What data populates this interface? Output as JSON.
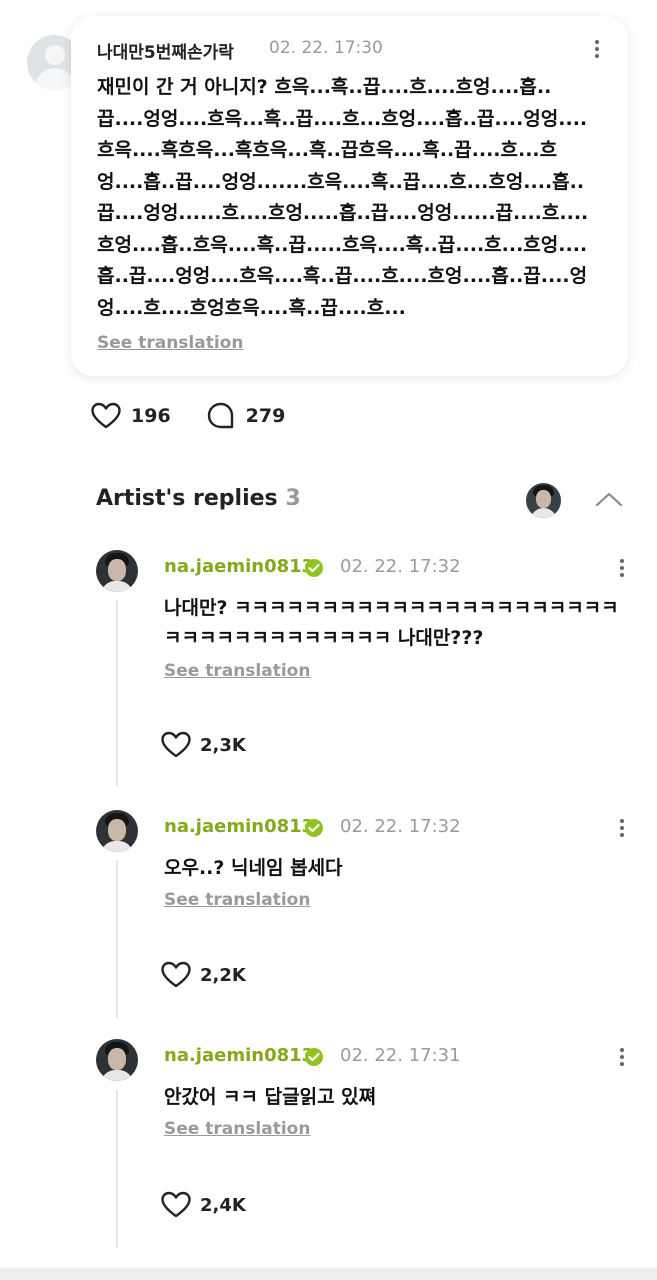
{
  "post": {
    "author": "나대만5번째손가락",
    "time": "02. 22. 17:30",
    "text": "재민이 간 거 아니지? 흐윽...흑..끕....흐....흐엉....흡..끕....엉엉....흐윽...흑..끕....흐...흐엉....흡..끕....엉엉....흐윽....흑흐윽...흑흐윽...흑..끕흐윽....흑..끕....흐...흐엉....흡..끕....엉엉.......흐윽....흑..끕....흐...흐엉....흡..끕....엉엉......흐....흐엉.....흡..끕....엉엉......끕....흐....흐엉....흡..흐윽....흑..끕.....흐윽....흑..끕....흐...흐엉....흡..끕....엉엉....흐윽....흑..끕....흐....흐엉....흡..끕....엉엉....흐....흐엉흐윽....흑..끕....흐...",
    "see_translation": "See translation",
    "likes": "196",
    "comments": "279"
  },
  "artist_replies": {
    "title": "Artist's replies",
    "count": "3"
  },
  "replies": [
    {
      "username": "na.jaemin0813",
      "time": "02. 22. 17:32",
      "text": "나대만? ㅋㅋㅋㅋㅋㅋㅋㅋㅋㅋㅋㅋㅋㅋㅋㅋㅋㅋㅋㅋㅋㅋㅋㅋㅋㅋㅋㅋㅋㅋㅋㅋㅋㅋㅋ 나대만???",
      "see_translation": "See translation",
      "likes": "2,3K"
    },
    {
      "username": "na.jaemin0813",
      "time": "02. 22. 17:32",
      "text": "오우..? 닉네임 봅세다",
      "see_translation": "See translation",
      "likes": "2,2K"
    },
    {
      "username": "na.jaemin0813",
      "time": "02. 22. 17:31",
      "text": "안갔어 ㅋㅋ 답글읽고 있쪄",
      "see_translation": "See translation",
      "likes": "2,4K"
    }
  ],
  "colors": {
    "artist_name": "#86a81c",
    "verified_badge": "#8fc31f",
    "muted": "#9a9a9a"
  },
  "icons": [
    "default-avatar-icon",
    "more-icon",
    "heart-icon",
    "comment-icon",
    "chevron-up-icon",
    "verified-badge-icon"
  ]
}
